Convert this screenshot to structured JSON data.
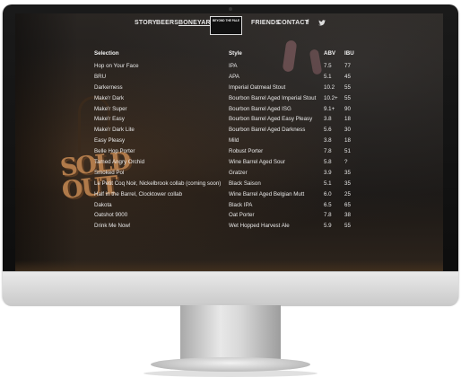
{
  "nav": {
    "items": [
      "STORY",
      "BEERS",
      "BONEYARD",
      "FRIENDS",
      "CONTACT"
    ],
    "active": "BONEYARD",
    "logo_line1": "BEYOND THE PALE",
    "social": {
      "facebook": "f",
      "twitter": "t"
    }
  },
  "sign": {
    "line1": "SOLD",
    "line2": "OUT"
  },
  "table": {
    "headers": {
      "selection": "Selection",
      "style": "Style",
      "abv": "ABV",
      "ibu": "IBU"
    },
    "rows": [
      {
        "selection": "Hop on Your Face",
        "style": "IPA",
        "abv": "7.5",
        "ibu": "77"
      },
      {
        "selection": "BRU",
        "style": "APA",
        "abv": "5.1",
        "ibu": "45"
      },
      {
        "selection": "Darkerness",
        "style": "Imperial Oatmeal Stout",
        "abv": "10.2",
        "ibu": "55"
      },
      {
        "selection": "Make'r Dark",
        "style": "Bourbon Barrel Aged Imperial Stout",
        "abv": "10.2+",
        "ibu": "55"
      },
      {
        "selection": "Make'r Super",
        "style": "Bourbon Barrel Aged ISG",
        "abv": "9.1+",
        "ibu": "90"
      },
      {
        "selection": "Make'r Easy",
        "style": "Bourbon Barrel Aged Easy Pleasy",
        "abv": "3.8",
        "ibu": "18"
      },
      {
        "selection": "Make'r Dark Lite",
        "style": "Bourbon Barrel Aged Darkness",
        "abv": "5.6",
        "ibu": "30"
      },
      {
        "selection": "Easy Pleasy",
        "style": "Mild",
        "abv": "3.8",
        "ibu": "18"
      },
      {
        "selection": "Belle Hop Porter",
        "style": "Robust Porter",
        "abv": "7.8",
        "ibu": "51"
      },
      {
        "selection": "Tamed Angry Orchid",
        "style": "Wine Barrel Aged Sour",
        "abv": "5.8",
        "ibu": "?"
      },
      {
        "selection": "Smoked Pol",
        "style": "Gratzer",
        "abv": "3.9",
        "ibu": "35"
      },
      {
        "selection": "Le Petit Coq Noir, Nickelbrook collab (coming soon)",
        "style": "Black Saison",
        "abv": "5.1",
        "ibu": "35"
      },
      {
        "selection": "Half in the Barrel, Clocktower collab",
        "style": "Wine Barrel Aged Belgian Mutt",
        "abv": "6.0",
        "ibu": "25"
      },
      {
        "selection": "Dakota",
        "style": "Black IPA",
        "abv": "6.5",
        "ibu": "65"
      },
      {
        "selection": "Oatshot 9000",
        "style": "Oat Porter",
        "abv": "7.8",
        "ibu": "38"
      },
      {
        "selection": "Drink Me Now!",
        "style": "Wet Hopped Harvest Ale",
        "abv": "5.9",
        "ibu": "55"
      }
    ]
  }
}
